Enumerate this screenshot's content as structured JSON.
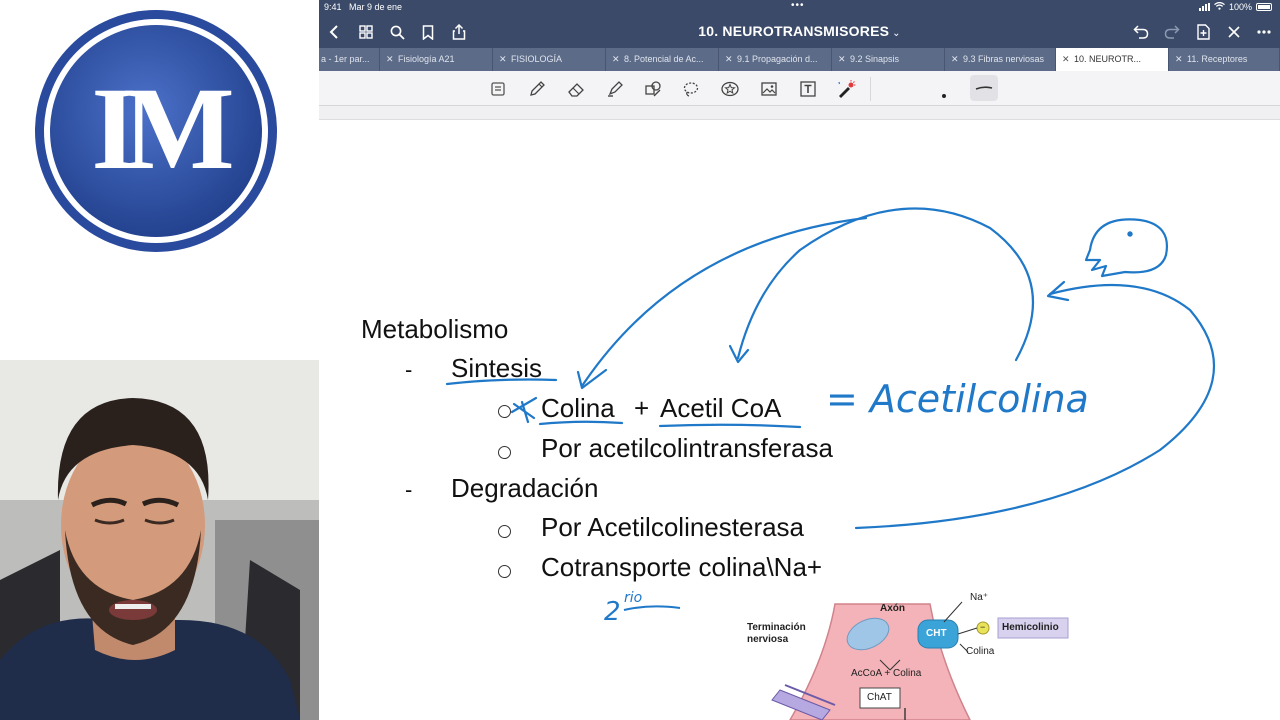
{
  "logo": {
    "letters": "IM"
  },
  "statusbar": {
    "time": "9:41",
    "date": "Mar 9 de ene",
    "battery": "100%"
  },
  "navbar": {
    "title": "10. NEUROTRANSMISORES",
    "title_chevron": "⌄"
  },
  "tabs": [
    {
      "label": "a - 1er par...",
      "active": false
    },
    {
      "label": "Fisiología A21",
      "active": false
    },
    {
      "label": "FISIOLOGÍA",
      "active": false
    },
    {
      "label": "8. Potencial de Ac...",
      "active": false
    },
    {
      "label": "9.1 Propagación d...",
      "active": false
    },
    {
      "label": "9.2 Sinapsis",
      "active": false
    },
    {
      "label": "9.3 Fibras nerviosas",
      "active": false
    },
    {
      "label": "10. NEUROTR...",
      "active": true
    },
    {
      "label": "11. Receptores",
      "active": false
    }
  ],
  "notes": {
    "heading": "Metabolismo",
    "dash": "-",
    "sintesis": "Sintesis",
    "colina": "Colina",
    "plus": "+",
    "acetil": "Acetil CoA",
    "por_acetiltransferasa": "Por acetilcolintransferasa",
    "degradacion": "Degradación",
    "por_acetilcolinesterasa": "Por Acetilcolinesterasa",
    "cotransporte": "Cotransporte colina\\Na+"
  },
  "handwriting": {
    "equals_acetilcolina": "= Acetilcolina",
    "segundo": "2",
    "segundo_sup": "rio"
  },
  "diagram": {
    "terminacion": "Terminación nerviosa",
    "axon": "Axón",
    "na": "Na⁺",
    "cht": "CHT",
    "minus": "−",
    "hemicolinio": "Hemicolinio",
    "colina": "Colina",
    "acoa_colina": "AcCoA + Colina",
    "chat": "ChAT"
  },
  "colors": {
    "nav": "#3a4a68",
    "tabbar": "#5c6b87",
    "ink": "#1f78c8",
    "logo_blue": "#2d4fa3"
  }
}
